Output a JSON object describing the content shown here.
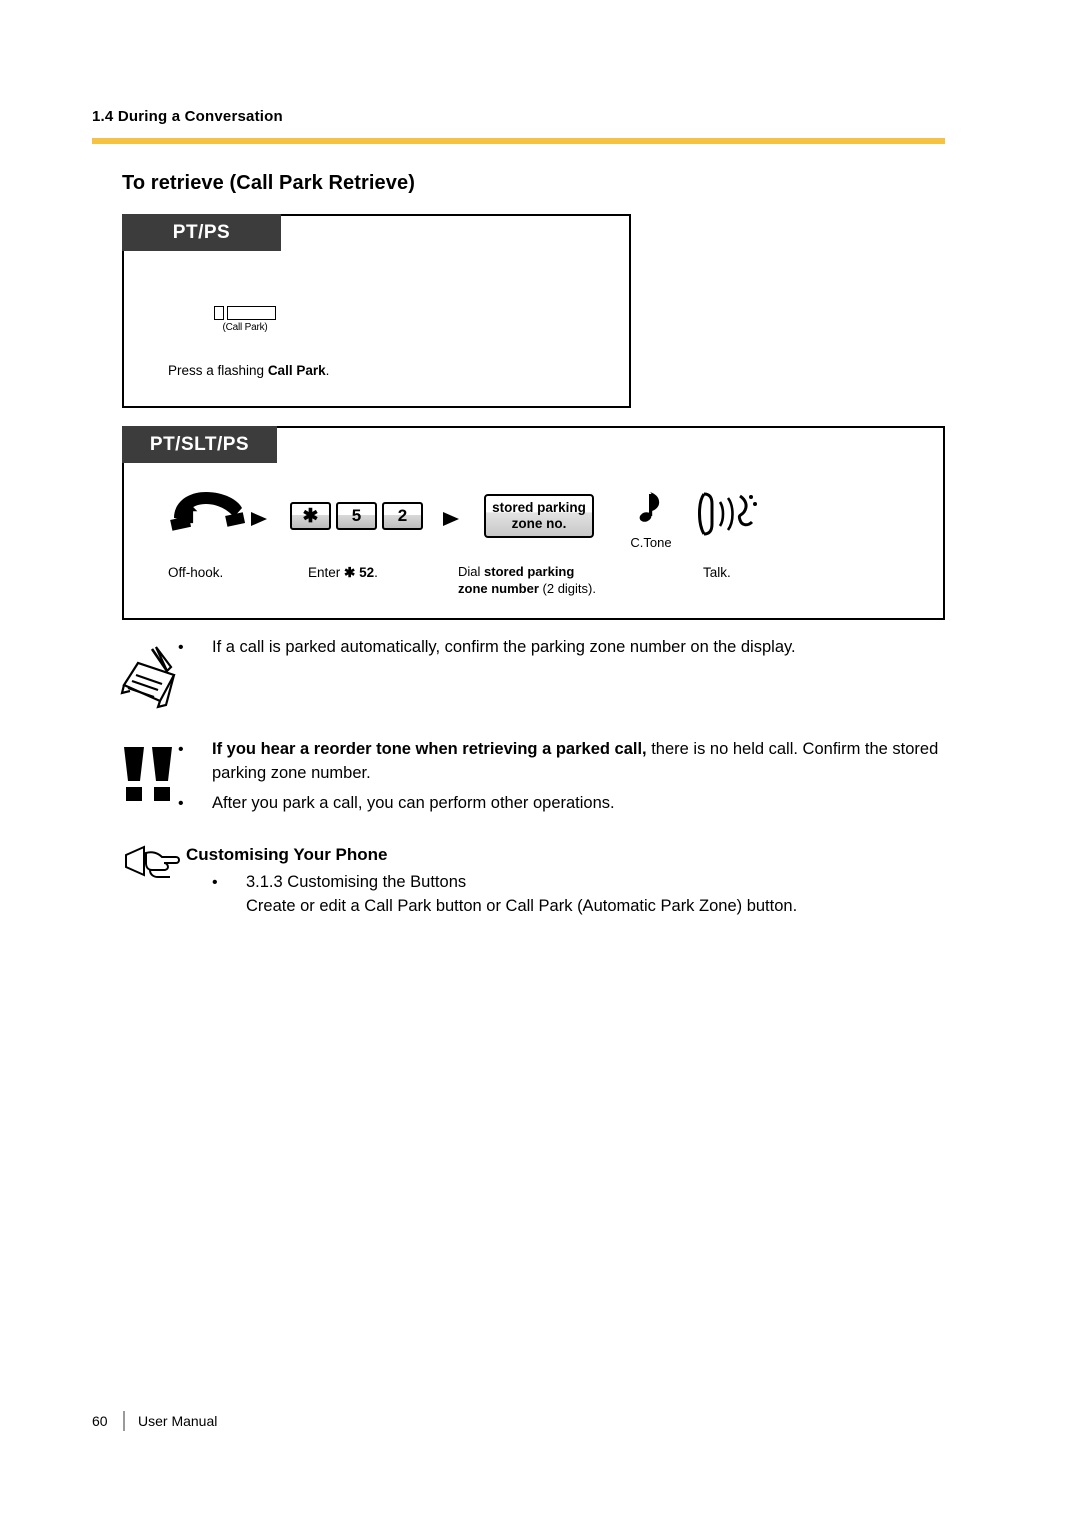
{
  "header": {
    "section": "1.4 During a Conversation"
  },
  "title": "To retrieve (Call Park Retrieve)",
  "box1": {
    "tab": "PT/PS",
    "button_label": "(Call Park)",
    "instruction_prefix": "Press a flashing ",
    "instruction_bold": "Call Park",
    "instruction_suffix": "."
  },
  "box2": {
    "tab": "PT/SLT/PS",
    "keys": [
      "✱",
      "5",
      "2"
    ],
    "display_line1": "stored parking",
    "display_line2": "zone no.",
    "ctone_label": "C.Tone",
    "captions": {
      "offhook": "Off-hook.",
      "enter_prefix": "Enter ",
      "enter_bold": "✱ 52",
      "enter_suffix": ".",
      "dial_prefix": "Dial ",
      "dial_bold1": "stored parking",
      "dial_bold2": "zone number",
      "dial_suffix": " (2 digits).",
      "talk": "Talk."
    }
  },
  "notes": {
    "note1": "If a call is parked automatically, confirm the parking zone number on the display.",
    "warn1_bold": "If you hear a reorder tone when retrieving a parked call,",
    "warn1_rest": " there is no held call. Confirm the stored parking zone number.",
    "warn2": "After you park a call, you can perform other operations."
  },
  "customising": {
    "title": "Customising Your Phone",
    "item": "3.1.3 Customising the Buttons",
    "detail": "Create or edit a Call Park button or Call Park (Automatic Park Zone) button."
  },
  "footer": {
    "page": "60",
    "label": "User Manual"
  },
  "colors": {
    "rule": "#f5c242",
    "tab_bg": "#3c3c3c"
  }
}
